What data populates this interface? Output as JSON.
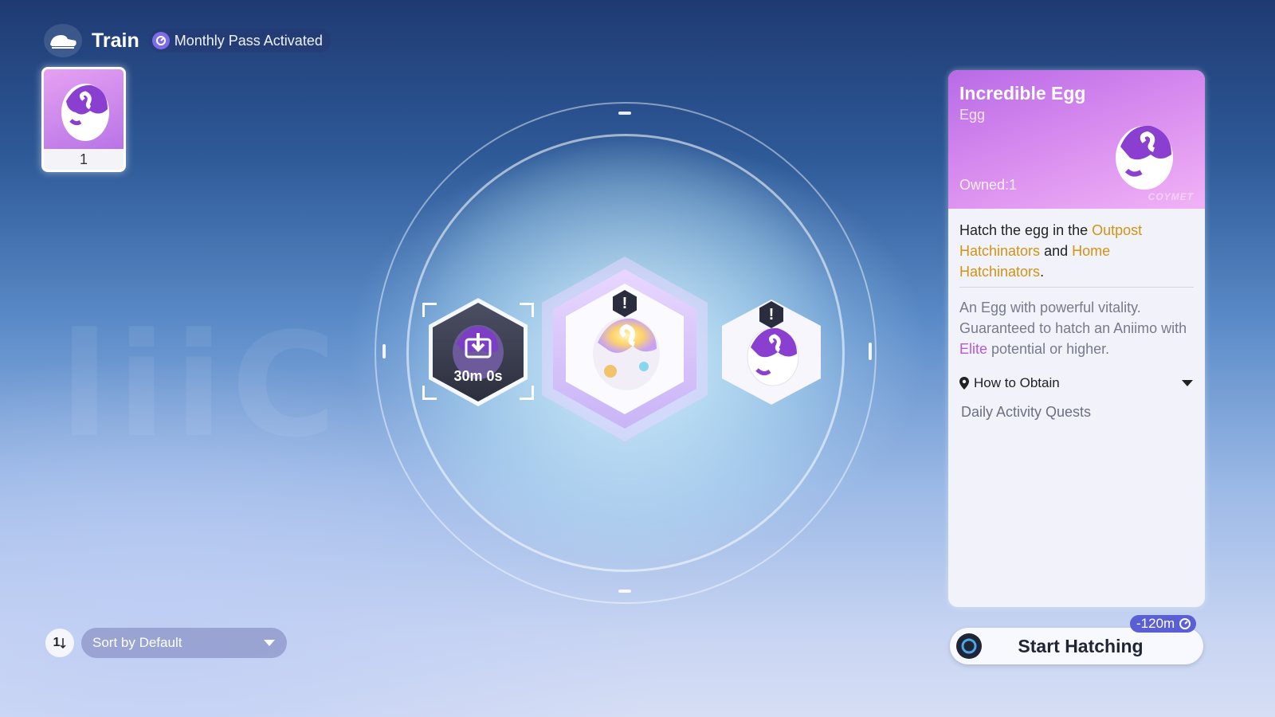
{
  "header": {
    "title": "Train",
    "pass_label": "Monthly Pass Activated"
  },
  "inventory": {
    "items": [
      {
        "name": "Incredible Egg",
        "count": "1"
      }
    ]
  },
  "hatchery": {
    "slots": [
      {
        "state": "incubating",
        "timer": "30m 0s"
      },
      {
        "state": "ready",
        "alert": "!"
      },
      {
        "state": "ready",
        "alert": "!"
      }
    ]
  },
  "detail": {
    "name": "Incredible Egg",
    "type": "Egg",
    "owned_label": "Owned:",
    "owned_value": "1",
    "brand": "COYMET",
    "desc_intro": "Hatch the egg in the ",
    "desc_hl1": "Outpost Hatchinators",
    "desc_and": " and ",
    "desc_hl2": "Home Hatchinators",
    "desc_end": ".",
    "desc2_a": "An Egg with powerful vitality. Guaranteed to hatch an Aniimo with ",
    "desc2_elite": "Elite",
    "desc2_b": " potential or higher.",
    "obtain_label": "How to Obtain",
    "obtain_source": "Daily Activity Quests"
  },
  "action": {
    "cost": "-120m",
    "start_label": "Start Hatching"
  },
  "sort": {
    "toggle_label": "1",
    "selected": "Sort by Default"
  },
  "colors": {
    "accent_purple": "#b86ae6",
    "highlight_gold": "#d49212",
    "elite_purple": "#b35ad8",
    "cost_badge": "#5a5fd6"
  }
}
